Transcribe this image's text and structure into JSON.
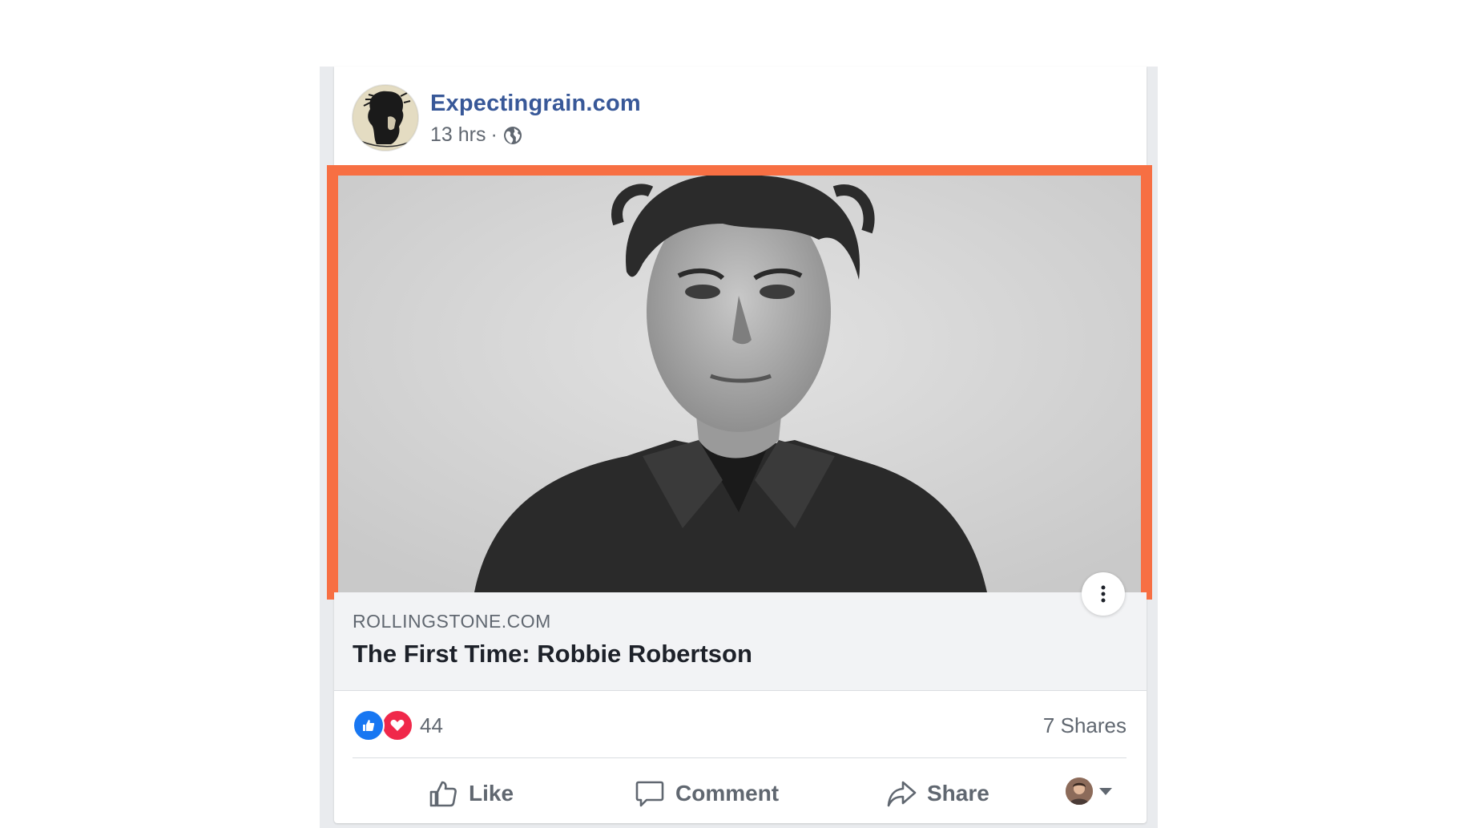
{
  "post": {
    "author": "Expectingrain.com",
    "time": "13 hrs",
    "separator": "·",
    "privacy_icon": "globe-icon",
    "link": {
      "domain": "ROLLINGSTONE.COM",
      "title": "The First Time: Robbie Robertson"
    },
    "reactions": {
      "icons": [
        "like-reaction-icon",
        "love-reaction-icon"
      ],
      "count": "44"
    },
    "shares": "7 Shares",
    "actions": {
      "like": "Like",
      "comment": "Comment",
      "share": "Share"
    }
  },
  "colors": {
    "author_link": "#385898",
    "highlight": "#f76f43",
    "like_blue": "#1877f2",
    "love_red": "#f0284a",
    "secondary_text": "#606770"
  }
}
